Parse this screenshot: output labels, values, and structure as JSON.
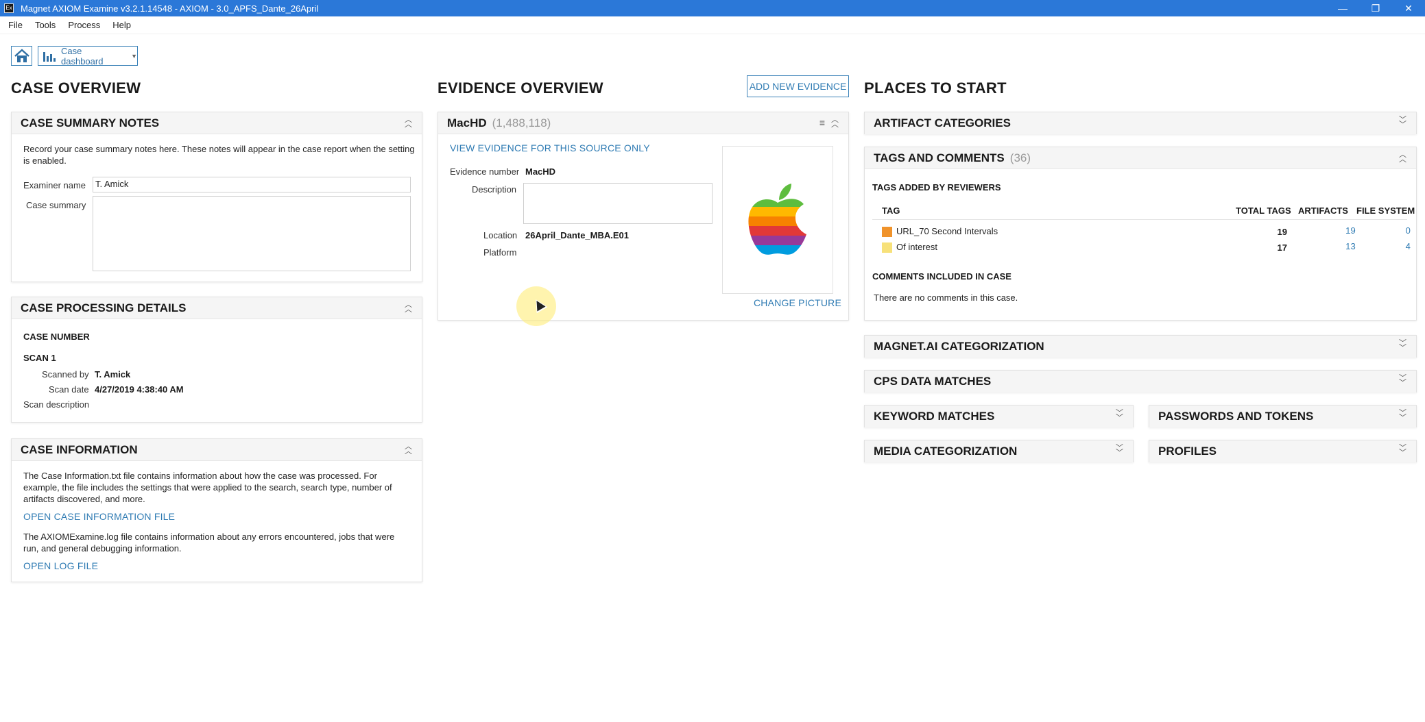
{
  "window": {
    "title": "Magnet AXIOM Examine v3.2.1.14548 - AXIOM - 3.0_APFS_Dante_26April",
    "minimize": "—",
    "restore": "❐",
    "close": "✕"
  },
  "menu": [
    "File",
    "Tools",
    "Process",
    "Help"
  ],
  "toolbar": {
    "view_label": "Case dashboard"
  },
  "case_overview": {
    "title": "CASE OVERVIEW",
    "summary_notes": {
      "title": "CASE SUMMARY NOTES",
      "description": "Record your case summary notes here. These notes will appear in the case report when the setting is enabled.",
      "examiner_label": "Examiner name",
      "examiner_value": "T. Amick",
      "case_summary_label": "Case summary",
      "case_summary_value": ""
    },
    "processing": {
      "title": "CASE PROCESSING DETAILS",
      "case_number_label": "CASE NUMBER",
      "scan_label": "SCAN 1",
      "scanned_by_label": "Scanned by",
      "scanned_by_value": "T. Amick",
      "scan_date_label": "Scan date",
      "scan_date_value": "4/27/2019 4:38:40 AM",
      "scan_description_label": "Scan description"
    },
    "information": {
      "title": "CASE INFORMATION",
      "text1": "The Case Information.txt file contains information about how the case was processed. For example, the file includes the settings that were applied to the search, search type, number of artifacts discovered, and more.",
      "link1": "OPEN CASE INFORMATION FILE",
      "text2": "The AXIOMExamine.log file contains information about any errors encountered, jobs that were run, and general debugging information.",
      "link2": "OPEN LOG FILE"
    }
  },
  "evidence_overview": {
    "title": "EVIDENCE OVERVIEW",
    "add_button": "ADD NEW EVIDENCE",
    "source": {
      "name": "MacHD",
      "count": "(1,488,118)",
      "view_link": "VIEW EVIDENCE FOR THIS SOURCE ONLY",
      "evidence_number_label": "Evidence number",
      "evidence_number_value": "MacHD",
      "description_label": "Description",
      "location_label": "Location",
      "location_value": "26April_Dante_MBA.E01",
      "platform_label": "Platform",
      "change_picture": "CHANGE PICTURE"
    }
  },
  "places_to_start": {
    "title": "PLACES TO START",
    "artifact_categories": "ARTIFACT CATEGORIES",
    "tags_and_comments": {
      "title": "TAGS AND COMMENTS",
      "count": "(36)",
      "tags_added_label": "TAGS ADDED BY REVIEWERS",
      "columns": [
        "TAG",
        "TOTAL TAGS",
        "ARTIFACTS",
        "FILE SYSTEM"
      ],
      "rows": [
        {
          "name": "URL_70 Second Intervals",
          "color": "#f0932b",
          "total": "19",
          "artifacts": "19",
          "file_system": "0"
        },
        {
          "name": "Of interest",
          "color": "#f7e17a",
          "total": "17",
          "artifacts": "13",
          "file_system": "4"
        }
      ],
      "comments_label": "COMMENTS INCLUDED IN CASE",
      "comments_empty": "There are no comments in this case."
    },
    "magnet_ai": "MAGNET.AI CATEGORIZATION",
    "cps": "CPS DATA MATCHES",
    "keyword": "KEYWORD MATCHES",
    "passwords": "PASSWORDS AND TOKENS",
    "media": "MEDIA CATEGORIZATION",
    "profiles": "PROFILES"
  },
  "colors": {
    "titlebar": "#2b78d8",
    "link": "#2f7bb3",
    "accent_border": "#3b82b8"
  }
}
